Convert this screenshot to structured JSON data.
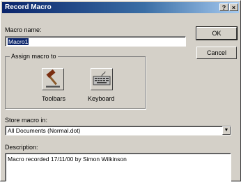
{
  "window": {
    "title": "Record Macro",
    "help_label": "?",
    "close_label": "×"
  },
  "macro_name": {
    "label": "Macro name:",
    "value": "Macro1"
  },
  "buttons": {
    "ok": "OK",
    "cancel": "Cancel"
  },
  "assign_group": {
    "legend": "Assign macro to",
    "toolbars_label": "Toolbars",
    "keyboard_label": "Keyboard"
  },
  "store": {
    "label": "Store macro in:",
    "value": "All Documents (Normal.dot)",
    "dropdown_icon": "▼"
  },
  "description": {
    "label": "Description:",
    "value": "Macro recorded 17/11/00 by Simon Wilkinson"
  },
  "colors": {
    "titlebar_start": "#0a246a",
    "titlebar_end": "#a6caf0",
    "face": "#d4d0c8"
  }
}
